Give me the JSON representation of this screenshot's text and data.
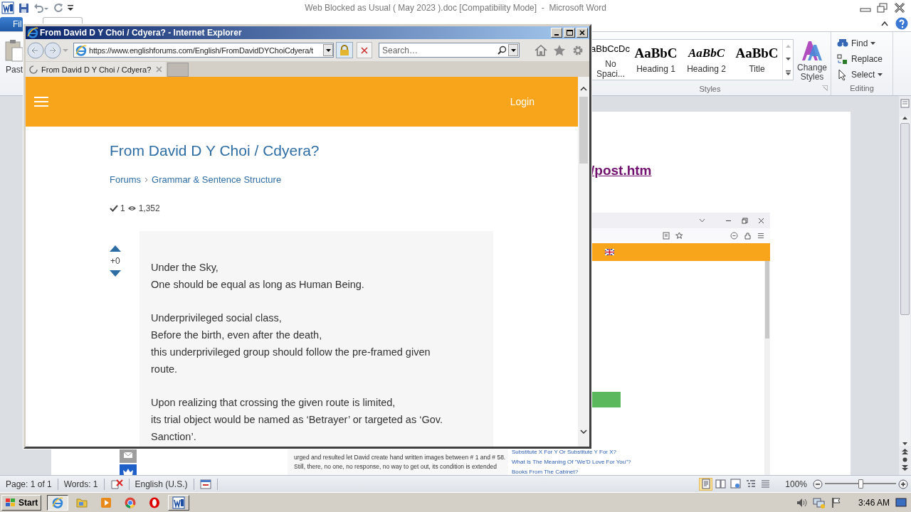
{
  "word": {
    "title": "Web Blocked as Usual ( May 2023 ).doc [Compatibility Mode]  -  Microsoft Word",
    "file_tab": "Fil",
    "paste_label": "Past",
    "styles": [
      {
        "preview": "aBbCcDc",
        "name": "No Spaci...",
        "kind": "plain"
      },
      {
        "preview": "AaBbC",
        "name": "Heading 1",
        "kind": "heading"
      },
      {
        "preview": "AaBbC",
        "name": "Heading 2",
        "kind": "heading-italic"
      },
      {
        "preview": "AaBbC",
        "name": "Title",
        "kind": "title"
      }
    ],
    "change_styles": "Change Styles",
    "styles_group": "Styles",
    "editing": [
      {
        "label": "Find",
        "kind": "find",
        "dropdown": true
      },
      {
        "label": "Replace",
        "kind": "replace",
        "dropdown": false
      },
      {
        "label": "Select",
        "kind": "select",
        "dropdown": true
      }
    ],
    "editing_group": "Editing"
  },
  "document": {
    "link": "/post.htm",
    "embedded_screenshot": {
      "paragraphs": [
        [
          "urged and resulted let David create hand written images between # 1 and # 58."
        ],
        [
          "Still, there, no one, no response, no way to get out, its condition is extended"
        ]
      ],
      "related_links": [
        "Substitute X For Y Or Substitute Y For X?",
        "What Is The Meaning Of \"We'D Love For You\"?",
        "Books From The Cabinet?"
      ]
    }
  },
  "status_bar": {
    "page": "Page: 1 of 1",
    "words": "Words: 1",
    "language": "English (U.S.)",
    "views": [
      {
        "kind": "print-layout",
        "selected": true
      },
      {
        "kind": "full-screen",
        "selected": false
      },
      {
        "kind": "web",
        "selected": false
      },
      {
        "kind": "outline",
        "selected": false
      },
      {
        "kind": "draft",
        "selected": false
      }
    ],
    "zoom": "100%",
    "zoom_slider": {
      "level": 0.5
    }
  },
  "taskbar": {
    "start": "Start",
    "apps": [
      {
        "kind": "ie",
        "running": true,
        "selected": true
      },
      {
        "kind": "folder",
        "running": false,
        "selected": false
      },
      {
        "kind": "media",
        "running": false,
        "selected": false
      },
      {
        "kind": "chrome",
        "running": false,
        "selected": false
      },
      {
        "kind": "opera",
        "running": false,
        "selected": false
      },
      {
        "kind": "word",
        "running": true,
        "selected": false
      }
    ],
    "clock": "3:46 AM"
  },
  "ie": {
    "title": "From David D Y Choi / Cdyera? - Internet Explorer",
    "address": "https://www.englishforums.com/English/FromDavidDYChoiCdyera/t",
    "search_placeholder": "Search…",
    "tabs": [
      {
        "label": "From David D Y Choi / Cdyera?",
        "loading": true,
        "selected": true
      }
    ],
    "page": {
      "login": "Login",
      "title": "From David D Y Choi / Cdyera?",
      "breadcrumbs": [
        "Forums",
        "Grammar & Sentence Structure"
      ],
      "answers": "1",
      "views": "1,352",
      "votes": "+0",
      "paragraphs": [
        [
          "Under the Sky,",
          "One should be equal as long as Human Being."
        ],
        [
          "Underprivileged social class,",
          "Before the birth, even after the death,",
          "this underprivileged group should follow the pre-framed given",
          "route."
        ],
        [
          "Upon realizing that crossing the given route is limited,",
          "its trial object would be named as ‘Betrayer’ or targeted as ‘Gov.",
          "Sanction’."
        ]
      ]
    }
  }
}
